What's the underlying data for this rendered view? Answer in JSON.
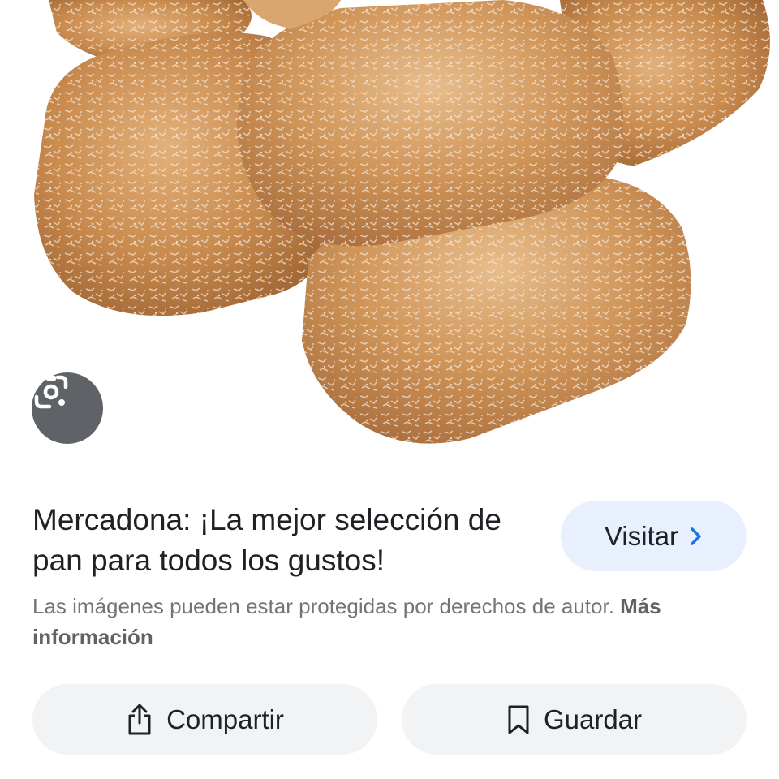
{
  "image": {
    "subject": "bread rolls",
    "lens_icon": "google-lens-icon"
  },
  "result": {
    "title": "Mercadona: ¡La mejor selección de pan para todos los gustos!",
    "visit_label": "Visitar",
    "visit_icon": "chevron-right-icon"
  },
  "notice": {
    "text": "Las imágenes pueden estar protegidas por derechos de autor.",
    "link": "Más información"
  },
  "actions": {
    "share_label": "Compartir",
    "share_icon": "share-icon",
    "save_label": "Guardar",
    "save_icon": "bookmark-icon"
  },
  "colors": {
    "accent": "#1a73e8",
    "visit_bg": "#e8f0fe",
    "button_bg": "#f1f3f4",
    "lens_bg": "#5f6368"
  }
}
